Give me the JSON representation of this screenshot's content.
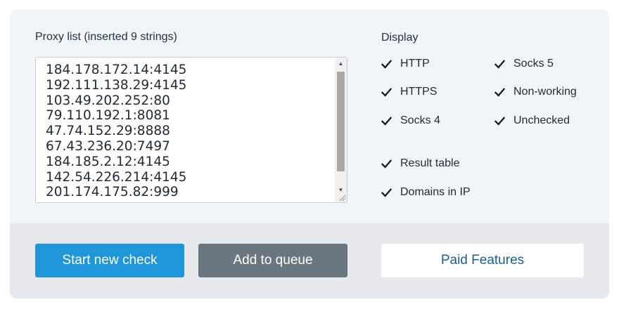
{
  "proxy_list": {
    "label": "Proxy list (inserted 9 strings)",
    "lines": [
      "184.178.172.14:4145",
      "192.111.138.29:4145",
      "103.49.202.252:80",
      "79.110.192.1:8081",
      "47.74.152.29:8888",
      "67.43.236.20:7497",
      "184.185.2.12:4145",
      "142.54.226.214:4145",
      "201.174.175.82:999"
    ],
    "text": "184.178.172.14:4145\n192.111.138.29:4145\n103.49.202.252:80\n79.110.192.1:8081\n47.74.152.29:8888\n67.43.236.20:7497\n184.185.2.12:4145\n142.54.226.214:4145\n201.174.175.82:999"
  },
  "display": {
    "label": "Display",
    "options": {
      "http": {
        "label": "HTTP",
        "checked": true
      },
      "https": {
        "label": "HTTPS",
        "checked": true
      },
      "socks4": {
        "label": "Socks 4",
        "checked": true
      },
      "socks5": {
        "label": "Socks 5",
        "checked": true
      },
      "non_working": {
        "label": "Non-working",
        "checked": true
      },
      "unchecked": {
        "label": "Unchecked",
        "checked": true
      },
      "result_table": {
        "label": "Result table",
        "checked": true
      },
      "domains_in_ip": {
        "label": "Domains in IP",
        "checked": true
      }
    }
  },
  "buttons": {
    "start": "Start new check",
    "queue": "Add to queue",
    "paid": "Paid Features"
  },
  "colors": {
    "panel_bg": "#f0f5f9",
    "footer_bg": "#e6e9ec",
    "primary": "#1e96d8",
    "secondary": "#6a777e",
    "link": "#1e5f92"
  },
  "icons": {
    "checkbox": "checkmark-icon",
    "scroll_up": "scroll-up-arrow-icon",
    "scroll_down": "scroll-down-arrow-icon",
    "resize": "resize-grip-icon"
  }
}
